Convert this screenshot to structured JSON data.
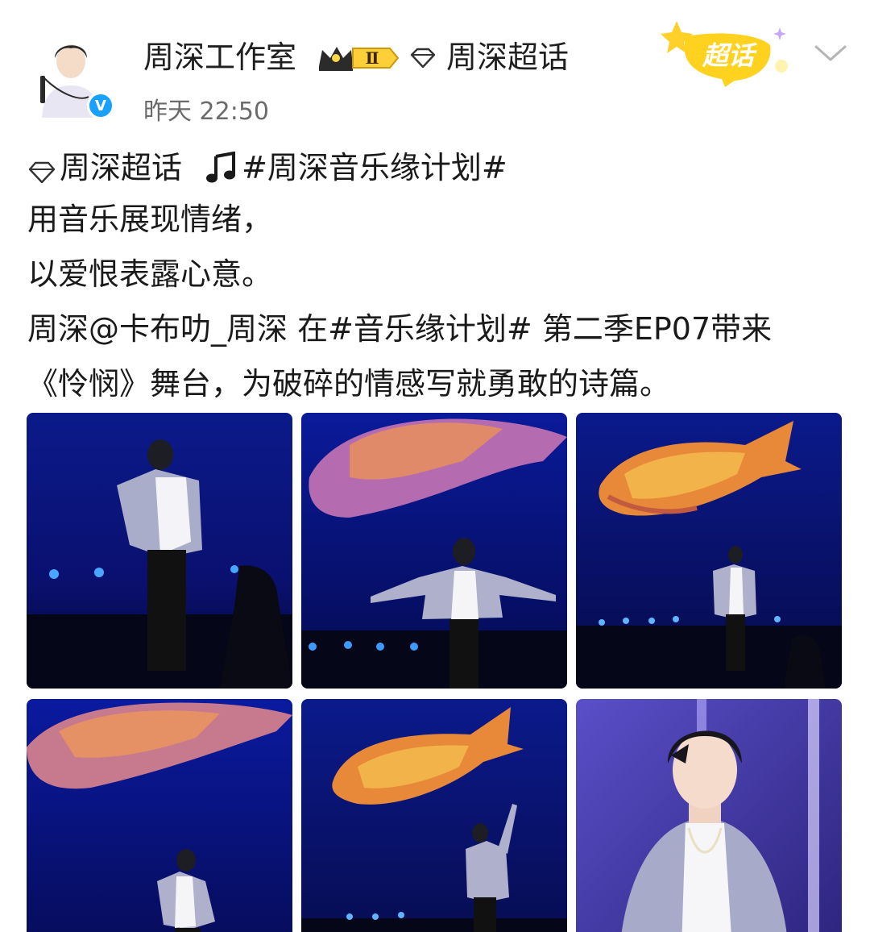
{
  "header": {
    "username": "周深工作室",
    "vip_level": "Ⅱ",
    "verified_mark": "V",
    "supertopic_link": "周深超话",
    "timestamp": "昨天 22:50",
    "chaohua_button": "超话",
    "icons": [
      "crown-icon",
      "gem-icon",
      "chevron-down-icon",
      "star-icon"
    ]
  },
  "post": {
    "line1": {
      "topic": "周深超话",
      "hashtag": "#周深音乐缘计划#"
    },
    "line2": "用音乐展现情绪，",
    "line3": "以爱恨表露心意。",
    "line4": "周深@卡布叻_周深 在#音乐缘计划# 第二季EP07带来",
    "line5": "《怜悯》舞台，为破碎的情感写就勇敢的诗篇。"
  },
  "images": [
    {
      "alt": "stage photo 1"
    },
    {
      "alt": "stage photo 2"
    },
    {
      "alt": "stage photo 3"
    },
    {
      "alt": "stage photo 4"
    },
    {
      "alt": "stage photo 5"
    },
    {
      "alt": "stage photo 6"
    }
  ],
  "colors": {
    "stage_blue": "#0a0f6e",
    "chaohua_yellow": "#ffd21f",
    "verified_blue": "#1aa1ff"
  }
}
